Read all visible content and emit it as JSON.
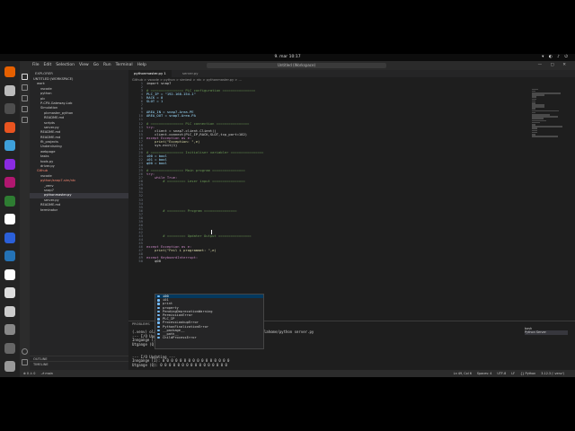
{
  "topbar": {
    "clock": "9. mar  10:17"
  },
  "vscode": {
    "menu": [
      "File",
      "Edit",
      "Selection",
      "View",
      "Go",
      "Run",
      "Terminal",
      "Help"
    ],
    "command_center": "Untitled (Workspace)"
  },
  "sidebar": {
    "title": "EXPLORER",
    "items": [
      {
        "label": "UNTITLED (WORKSPACE)",
        "indent": 0
      },
      {
        "label": "work",
        "indent": 1
      },
      {
        "label": "vscode",
        "indent": 2
      },
      {
        "label": "python",
        "indent": 2
      },
      {
        "label": "plc",
        "indent": 2
      },
      {
        "label": "P-CPX-Gateway-Lab",
        "indent": 2
      },
      {
        "label": "Simulation",
        "indent": 2
      },
      {
        "label": "plcmaster_python",
        "indent": 3
      },
      {
        "label": "README.md",
        "indent": 3
      },
      {
        "label": "scripts",
        "indent": 3
      },
      {
        "label": "server.py",
        "indent": 3
      },
      {
        "label": "README.md",
        "indent": 2
      },
      {
        "label": "README.md",
        "indent": 2
      },
      {
        "label": "flt_projects",
        "indent": 2
      },
      {
        "label": "Undervisning",
        "indent": 2
      },
      {
        "label": "webpage",
        "indent": 2
      },
      {
        "label": "tasks",
        "indent": 2
      },
      {
        "label": "tools.py",
        "indent": 2
      },
      {
        "label": "driver.py",
        "indent": 2
      },
      {
        "label": "Github",
        "indent": 1,
        "style": "red"
      },
      {
        "label": "vscode",
        "indent": 2
      },
      {
        "label": "python/snap7-sim/ntc",
        "indent": 2,
        "style": "red"
      },
      {
        "label": "_venv",
        "indent": 3
      },
      {
        "label": "snap7",
        "indent": 3
      },
      {
        "label": "pythonmaster.py",
        "indent": 3,
        "style": "sel"
      },
      {
        "label": "server.py",
        "indent": 3
      },
      {
        "label": "README.md",
        "indent": 2
      },
      {
        "label": "terminator",
        "indent": 2
      }
    ],
    "outline": "OUTLINE",
    "timeline": "TIMELINE"
  },
  "editor": {
    "tabs": [
      "pythonmaster.py 1",
      "server.py"
    ],
    "breadcrumb": "Github > vscode > python > simtest > ntc > pythonmaster.py > ...",
    "lines": [
      {
        "n": 1,
        "t": "tx",
        "c": "import snap7"
      },
      {
        "n": 2,
        "t": "tx",
        "c": ""
      },
      {
        "n": 3,
        "t": "cm",
        "c": "# ================ PLC configuration ================"
      },
      {
        "n": 4,
        "t": "vr",
        "c": "PLC_IP = \"192.168.154.1\""
      },
      {
        "n": 5,
        "t": "vr",
        "c": "RACK = 0"
      },
      {
        "n": 6,
        "t": "vr",
        "c": "SLOT = 1"
      },
      {
        "n": 7,
        "t": "tx",
        "c": ""
      },
      {
        "n": 8,
        "t": "tx",
        "c": ""
      },
      {
        "n": 9,
        "t": "vr",
        "c": "AREA_IN = snap7.Area.PE"
      },
      {
        "n": 10,
        "t": "vr",
        "c": "AREA_OUT = snap7.Area.PA"
      },
      {
        "n": 11,
        "t": "tx",
        "c": ""
      },
      {
        "n": 12,
        "t": "cm",
        "c": "# ================ PLC connection ================"
      },
      {
        "n": 13,
        "t": "kw",
        "c": "try:"
      },
      {
        "n": 14,
        "t": "tx",
        "c": "    client = snap7.client.Client()"
      },
      {
        "n": 15,
        "t": "tx",
        "c": "    client.connect(PLC_IP,RACK,SLOT,tcp_port=102)"
      },
      {
        "n": 16,
        "t": "kw",
        "c": "except Exception as e:"
      },
      {
        "n": 17,
        "t": "fn",
        "c": "    print(\"Exception: \",e)"
      },
      {
        "n": 18,
        "t": "tx",
        "c": "    sys.exit(1)"
      },
      {
        "n": 19,
        "t": "tx",
        "c": ""
      },
      {
        "n": 20,
        "t": "cm",
        "c": "# ================ Initialiser variabler ================"
      },
      {
        "n": 21,
        "t": "vr",
        "c": "i00 = bool"
      },
      {
        "n": 22,
        "t": "vr",
        "c": "i01 = bool"
      },
      {
        "n": 23,
        "t": "vr",
        "c": "q00 = bool"
      },
      {
        "n": 24,
        "t": "tx",
        "c": ""
      },
      {
        "n": 25,
        "t": "cm",
        "c": "# ================ Main program ================"
      },
      {
        "n": 26,
        "t": "kw",
        "c": "try:"
      },
      {
        "n": 27,
        "t": "kw",
        "c": "    while True:"
      },
      {
        "n": 28,
        "t": "cm",
        "c": "        # ========= Leser input ================"
      },
      {
        "n": 29,
        "t": "tx",
        "c": ""
      },
      {
        "n": 30,
        "t": "tx",
        "c": ""
      },
      {
        "n": 31,
        "t": "tx",
        "c": ""
      },
      {
        "n": 32,
        "t": "tx",
        "c": ""
      },
      {
        "n": 33,
        "t": "tx",
        "c": ""
      },
      {
        "n": 34,
        "t": "tx",
        "c": ""
      },
      {
        "n": 35,
        "t": "tx",
        "c": ""
      },
      {
        "n": 36,
        "t": "cm",
        "c": "        # ========= Program ================"
      },
      {
        "n": 37,
        "t": "tx",
        "c": ""
      },
      {
        "n": 38,
        "t": "tx",
        "c": ""
      },
      {
        "n": 39,
        "t": "tx",
        "c": ""
      },
      {
        "n": 40,
        "t": "tx",
        "c": ""
      },
      {
        "n": 41,
        "t": "tx",
        "c": ""
      },
      {
        "n": 42,
        "t": "tx",
        "c": ""
      },
      {
        "n": 43,
        "t": "cm",
        "c": "        # ========= Updater Output ================"
      },
      {
        "n": 44,
        "t": "tx",
        "c": ""
      },
      {
        "n": 45,
        "t": "tx",
        "c": ""
      },
      {
        "n": 46,
        "t": "kw",
        "c": "except Exception as e:"
      },
      {
        "n": 47,
        "t": "fn",
        "c": "    print(\"Feil i programmet: \",e)"
      },
      {
        "n": 48,
        "t": "tx",
        "c": ""
      },
      {
        "n": 49,
        "t": "kw",
        "c": "except KeyboardInterrupt:"
      },
      {
        "n": 50,
        "t": "tx",
        "c": "    q00"
      }
    ],
    "suggestions": [
      "i00",
      "i01",
      "print",
      "property",
      "PendingDeprecationWarning",
      "PermissionError",
      "PLC_IP",
      "ProcessLookupError",
      "PythonFinalizationError",
      "__package__",
      "__path__",
      "ChildProcessError"
    ]
  },
  "panel": {
    "tabs": [
      "PROBLEMS",
      "OUTPUT",
      "DEBUG CONSOLE",
      "TERMINAL",
      "PORTS"
    ],
    "terminal": [
      "(.venv) ola@ola:~/Github/vscode/python/snap7-sim/ntc$ /home/olahome/python server.py",
      "--- I/O Updating ---",
      "Inngange (I): 0 0 0 0 0 0 0 0 0 0 0 0 0 0 0 0",
      "Utgange (Q): 0 0 0 0 0 0 0 0 0 0 0 0 0 0 0 0",
      "",
      "",
      "--- I/O Updating ---",
      "Inngange (I): 0 0 0 0 0 0 0 0 0 0 0 0 0 0 0 0",
      "Utgange (Q): 0 0 0 0 0 0 0 0 0 0 0 0 0 0 0 0"
    ],
    "terminal_list": [
      "bash",
      "Python Server"
    ]
  },
  "statusbar": {
    "left": [
      "⊗ 0 ⚠ 0",
      "⎇ main"
    ],
    "right": [
      "Ln 49, Col 6",
      "Spaces: 4",
      "UTF-8",
      "LF",
      "{} Python",
      "3.12.3 ('.venv')"
    ]
  },
  "dock": {
    "icons": [
      {
        "name": "firefox-icon",
        "color": "#e66000"
      },
      {
        "name": "files-icon",
        "color": "#bbbbbb"
      },
      {
        "name": "terminal-icon",
        "color": "#4d4d4d"
      },
      {
        "name": "software-icon",
        "color": "#e95420"
      },
      {
        "name": "help-icon",
        "color": "#3ea0da"
      },
      {
        "name": "settings-icon",
        "color": "#8a2be2"
      },
      {
        "name": "app-icon",
        "color": "#b0176f"
      },
      {
        "name": "disk-icon",
        "color": "#2e7d32"
      },
      {
        "name": "chrome-icon",
        "color": "#ffffff"
      },
      {
        "name": "vpn-icon",
        "color": "#2b60d9"
      },
      {
        "name": "vscode-icon",
        "color": "#2472b6"
      },
      {
        "name": "github-icon",
        "color": "#ffffff"
      },
      {
        "name": "notes-icon",
        "color": "#dddddd"
      },
      {
        "name": "doc-icon",
        "color": "#cccccc"
      },
      {
        "name": "sheet-icon",
        "color": "#888888"
      },
      {
        "name": "trash-icon",
        "color": "#666666"
      },
      {
        "name": "apps-grid-icon",
        "color": "#999999"
      }
    ]
  }
}
